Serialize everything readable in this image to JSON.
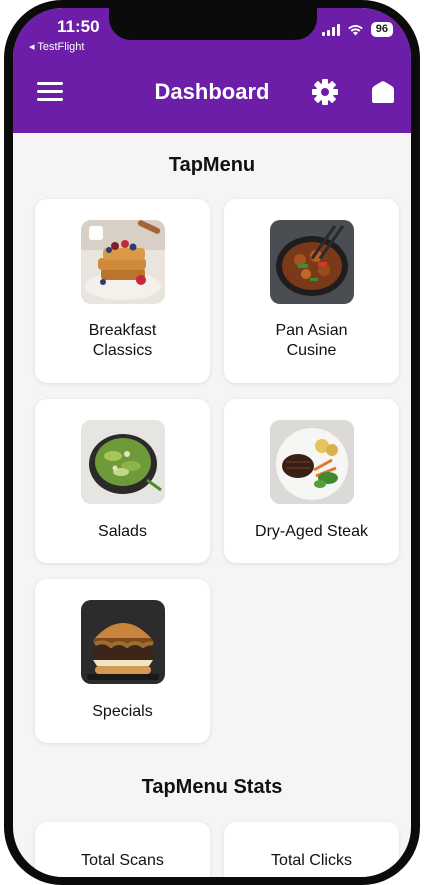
{
  "status_bar": {
    "time": "11:50",
    "back_app": "◂ TestFlight",
    "battery": "96"
  },
  "header": {
    "title": "Dashboard",
    "menu_icon": "hamburger-menu-icon",
    "settings_icon": "gear-icon",
    "home_icon": "home-icon"
  },
  "menu_section": {
    "title": "TapMenu",
    "categories": [
      {
        "line1": "Breakfast",
        "line2": "Classics",
        "image": "french-toast-photo"
      },
      {
        "line1": "Pan Asian",
        "line2": "Cusine",
        "image": "stir-fry-pan-photo"
      },
      {
        "line1": "Salads",
        "line2": "",
        "image": "salad-bowl-photo"
      },
      {
        "line1": "Dry-Aged Steak",
        "line2": "",
        "image": "steak-plate-photo"
      },
      {
        "line1": "Specials",
        "line2": "",
        "image": "burger-photo"
      }
    ]
  },
  "stats_section": {
    "title": "TapMenu Stats",
    "cards": [
      {
        "label": "Total Scans"
      },
      {
        "label": "Total Clicks"
      }
    ]
  },
  "colors": {
    "header_bg": "#6c1ea8",
    "page_bg": "#f5f5f6",
    "card_bg": "#ffffff"
  }
}
